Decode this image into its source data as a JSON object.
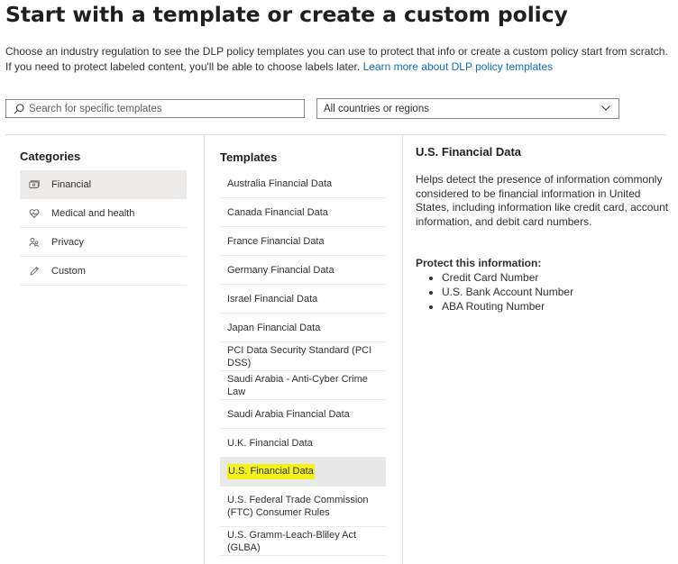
{
  "page": {
    "title": "Start with a template or create a custom policy",
    "description": "Choose an industry regulation to see the DLP policy templates you can use to protect that info or create a custom policy start from scratch. If you need to protect labeled content, you'll be able to choose labels later.",
    "learn_more_link": "Learn more about DLP policy templates"
  },
  "search": {
    "placeholder": "Search for specific templates",
    "icon": "search-icon"
  },
  "region_filter": {
    "selected": "All countries or regions",
    "icon": "chevron-down-icon"
  },
  "categories": {
    "header": "Categories",
    "items": [
      {
        "label": "Financial",
        "icon": "money-icon",
        "selected": true
      },
      {
        "label": "Medical and health",
        "icon": "heart-icon",
        "selected": false
      },
      {
        "label": "Privacy",
        "icon": "people-icon",
        "selected": false
      },
      {
        "label": "Custom",
        "icon": "pencil-icon",
        "selected": false
      }
    ]
  },
  "templates": {
    "header": "Templates",
    "items": [
      {
        "label": "Australia Financial Data"
      },
      {
        "label": "Canada Financial Data"
      },
      {
        "label": "France Financial Data"
      },
      {
        "label": "Germany Financial Data"
      },
      {
        "label": "Israel Financial Data"
      },
      {
        "label": "Japan Financial Data"
      },
      {
        "label": "PCI Data Security Standard (PCI DSS)"
      },
      {
        "label": "Saudi Arabia - Anti-Cyber Crime Law"
      },
      {
        "label": "Saudi Arabia Financial Data"
      },
      {
        "label": "U.K. Financial Data"
      },
      {
        "label": "U.S. Financial Data",
        "selected": true,
        "highlighted": true
      },
      {
        "label": "U.S. Federal Trade Commission (FTC) Consumer Rules"
      },
      {
        "label": "U.S. Gramm-Leach-Bliley Act (GLBA)"
      }
    ]
  },
  "details": {
    "title": "U.S. Financial Data",
    "description": "Helps detect the presence of information commonly considered to be financial information in United States, including information like credit card, account information, and debit card numbers.",
    "protect_label": "Protect this information:",
    "protect_items": [
      "Credit Card Number",
      "U.S. Bank Account Number",
      "ABA Routing Number"
    ]
  },
  "colors": {
    "link": "#0f6cbd",
    "highlight": "#f3f31a",
    "selected_bg": "#edebe9"
  }
}
